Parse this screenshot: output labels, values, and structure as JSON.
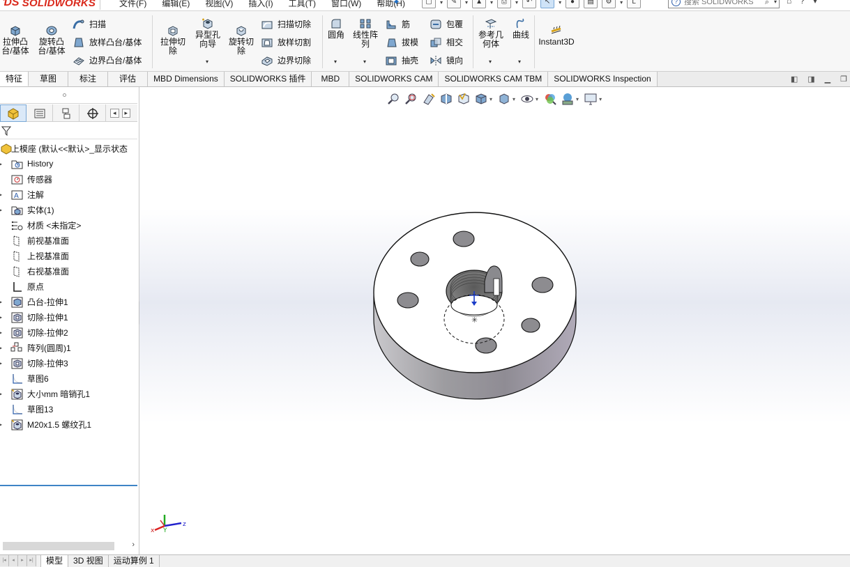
{
  "app": {
    "logo_text": "SOLIDWORKS",
    "brand_color": "#da291c"
  },
  "menu": [
    "文件(F)",
    "编辑(E)",
    "视图(V)",
    "插入(I)",
    "工具(T)",
    "窗口(W)",
    "帮助(H)"
  ],
  "search": {
    "placeholder": "搜索 SOLIDWORKS"
  },
  "ribbon": {
    "extrude_boss": "拉伸凸台/基体",
    "revolve_boss": "旋转凸台/基体",
    "sweep": "扫描",
    "loft_boss": "放样凸台/基体",
    "boundary_boss": "边界凸台/基体",
    "extrude_cut": "拉伸切除",
    "hole_wizard": "异型孔向导",
    "revolve_cut": "旋转切除",
    "swept_cut": "扫描切除",
    "loft_cut": "放样切割",
    "boundary_cut": "边界切除",
    "fillet": "圆角",
    "linear_pattern": "线性阵列",
    "rib": "筋",
    "draft": "拔模",
    "shell": "抽壳",
    "wrap": "包覆",
    "intersect": "相交",
    "mirror": "镜向",
    "ref_geometry": "参考几何体",
    "curves": "曲线",
    "instant3d": "Instant3D"
  },
  "tabs": [
    "特征",
    "草图",
    "标注",
    "评估",
    "MBD Dimensions",
    "SOLIDWORKS 插件",
    "MBD",
    "SOLIDWORKS CAM",
    "SOLIDWORKS CAM TBM",
    "SOLIDWORKS Inspection"
  ],
  "tree": {
    "root": "上模座 (默认<<默认>_显示状态",
    "items": [
      {
        "label": "History",
        "icon": "history-folder-icon",
        "arrow": true
      },
      {
        "label": "传感器",
        "icon": "sensor-icon",
        "arrow": false
      },
      {
        "label": "注解",
        "icon": "annotation-icon",
        "arrow": true
      },
      {
        "label": "实体(1)",
        "icon": "solid-bodies-icon",
        "arrow": true
      },
      {
        "label": "材质 <未指定>",
        "icon": "material-icon",
        "arrow": false
      },
      {
        "label": "前视基准面",
        "icon": "plane-icon",
        "arrow": false
      },
      {
        "label": "上视基准面",
        "icon": "plane-icon",
        "arrow": false
      },
      {
        "label": "右视基准面",
        "icon": "plane-icon",
        "arrow": false
      },
      {
        "label": "原点",
        "icon": "origin-icon",
        "arrow": false
      },
      {
        "label": "凸台-拉伸1",
        "icon": "extrude-boss-icon",
        "arrow": true
      },
      {
        "label": "切除-拉伸1",
        "icon": "extrude-cut-icon",
        "arrow": true
      },
      {
        "label": "切除-拉伸2",
        "icon": "extrude-cut-icon",
        "arrow": true
      },
      {
        "label": "阵列(圆周)1",
        "icon": "circular-pattern-icon",
        "arrow": true
      },
      {
        "label": "切除-拉伸3",
        "icon": "extrude-cut-icon",
        "arrow": true
      },
      {
        "label": "草图6",
        "icon": "sketch-icon",
        "arrow": false
      },
      {
        "label": "大小mm 暗销孔1",
        "icon": "hole-icon",
        "arrow": true
      },
      {
        "label": "草图13",
        "icon": "sketch-icon",
        "arrow": false
      },
      {
        "label": "M20x1.5 螺纹孔1",
        "icon": "hole-icon",
        "arrow": true
      }
    ]
  },
  "bottom_tabs": [
    "模型",
    "3D 视图",
    "运动算例 1"
  ],
  "colors": {
    "accent": "#3d84c6",
    "part_top": "#ffffff",
    "part_side": "#a9a6ad"
  }
}
